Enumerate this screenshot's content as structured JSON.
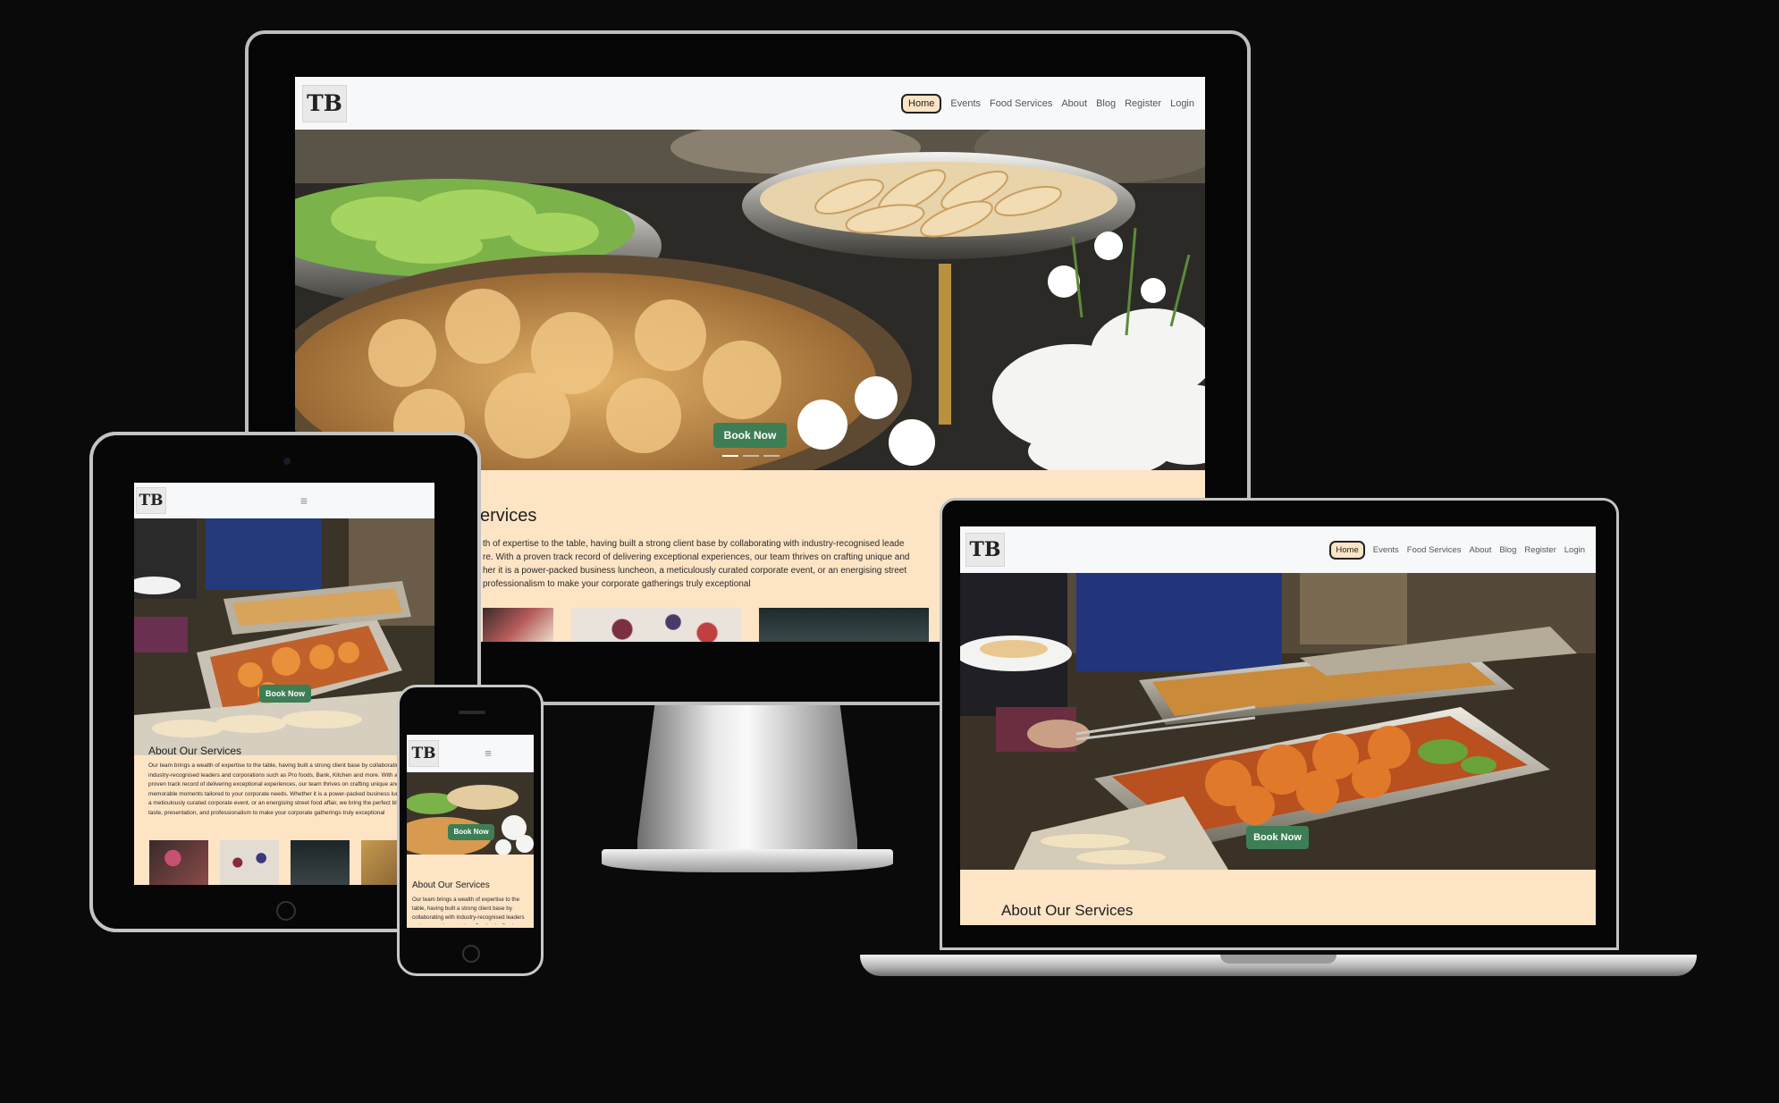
{
  "site": {
    "logo_text": "TB",
    "nav": [
      "Home",
      "Events",
      "Food Services",
      "About",
      "Blog",
      "Register",
      "Login"
    ],
    "active_nav": "Home",
    "menu_icon": "hamburger-menu-icon",
    "book_label": "Book Now",
    "about_title": "About Our Services",
    "about_title_cropped": "ervices",
    "about_text": "Our team brings a wealth of expertise to the table, having built a strong client base by collaborating with industry-recognised leaders and corporations such as Pro foods, Bank, Kitchen and more. With a proven track record of delivering exceptional experiences, our team thrives on crafting unique and memorable moments tailored to your corporate needs. Whether it is a power-packed business luncheon, a meticulously curated corporate event, or an energising street food affair, we bring the perfect blend of taste, presentation, and professionalism to make your corporate gatherings truly exceptional",
    "desktop_text_lines": [
      "th of expertise to the table, having built a strong client base by collaborating with industry-recognised leade",
      "re. With a proven track record of delivering exceptional experiences, our team thrives on crafting unique and",
      "her it is a power-packed business luncheon, a meticulously curated corporate event, or an energising street",
      "professionalism to make your corporate gatherings truly exceptional"
    ],
    "carousel": {
      "slides": 3,
      "active": 1
    }
  },
  "colors": {
    "background": "#0a0a0a",
    "nav_bg": "#f7f8f9",
    "section_bg": "#fde4c5",
    "button_green": "#3d7e55",
    "active_border": "#222222"
  }
}
